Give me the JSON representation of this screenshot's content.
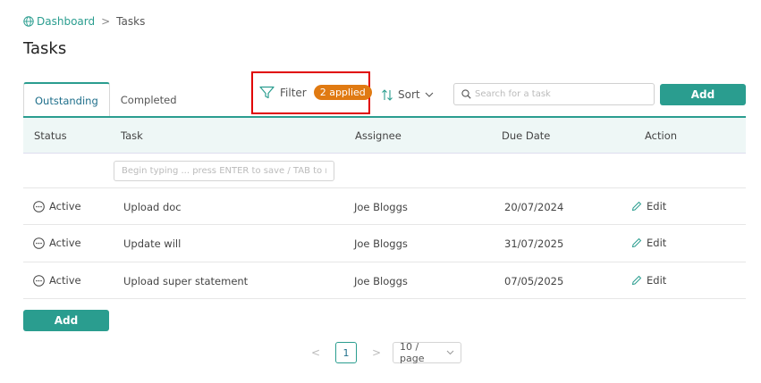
{
  "breadcrumb": {
    "home": "Dashboard",
    "separator": ">",
    "current": "Tasks"
  },
  "page_title": "Tasks",
  "tabs": [
    {
      "label": "Outstanding",
      "active": true
    },
    {
      "label": "Completed",
      "active": false
    }
  ],
  "toolbar": {
    "filter_label": "Filter",
    "filter_badge": "2 applied",
    "sort_label": "Sort",
    "search_placeholder": "Search for a task",
    "add_label": "Add"
  },
  "table": {
    "columns": [
      "Status",
      "Task",
      "Assignee",
      "Due Date",
      "Action"
    ],
    "new_task_placeholder": "Begin typing ... press ENTER to save / TAB to m...",
    "rows": [
      {
        "status": "Active",
        "task": "Upload doc",
        "assignee": "Joe Bloggs",
        "due": "20/07/2024",
        "action": "Edit"
      },
      {
        "status": "Active",
        "task": "Update will",
        "assignee": "Joe Bloggs",
        "due": "31/07/2025",
        "action": "Edit"
      },
      {
        "status": "Active",
        "task": "Upload super statement",
        "assignee": "Joe Bloggs",
        "due": "07/05/2025",
        "action": "Edit"
      }
    ]
  },
  "bottom_add_label": "Add",
  "pagination": {
    "prev": "<",
    "current_page": "1",
    "next": ">",
    "page_size": "10 / page"
  },
  "colors": {
    "accent": "#2a9d8f",
    "badge": "#e07a12",
    "highlight": "#e00000",
    "header_bg": "#eef7f6"
  }
}
